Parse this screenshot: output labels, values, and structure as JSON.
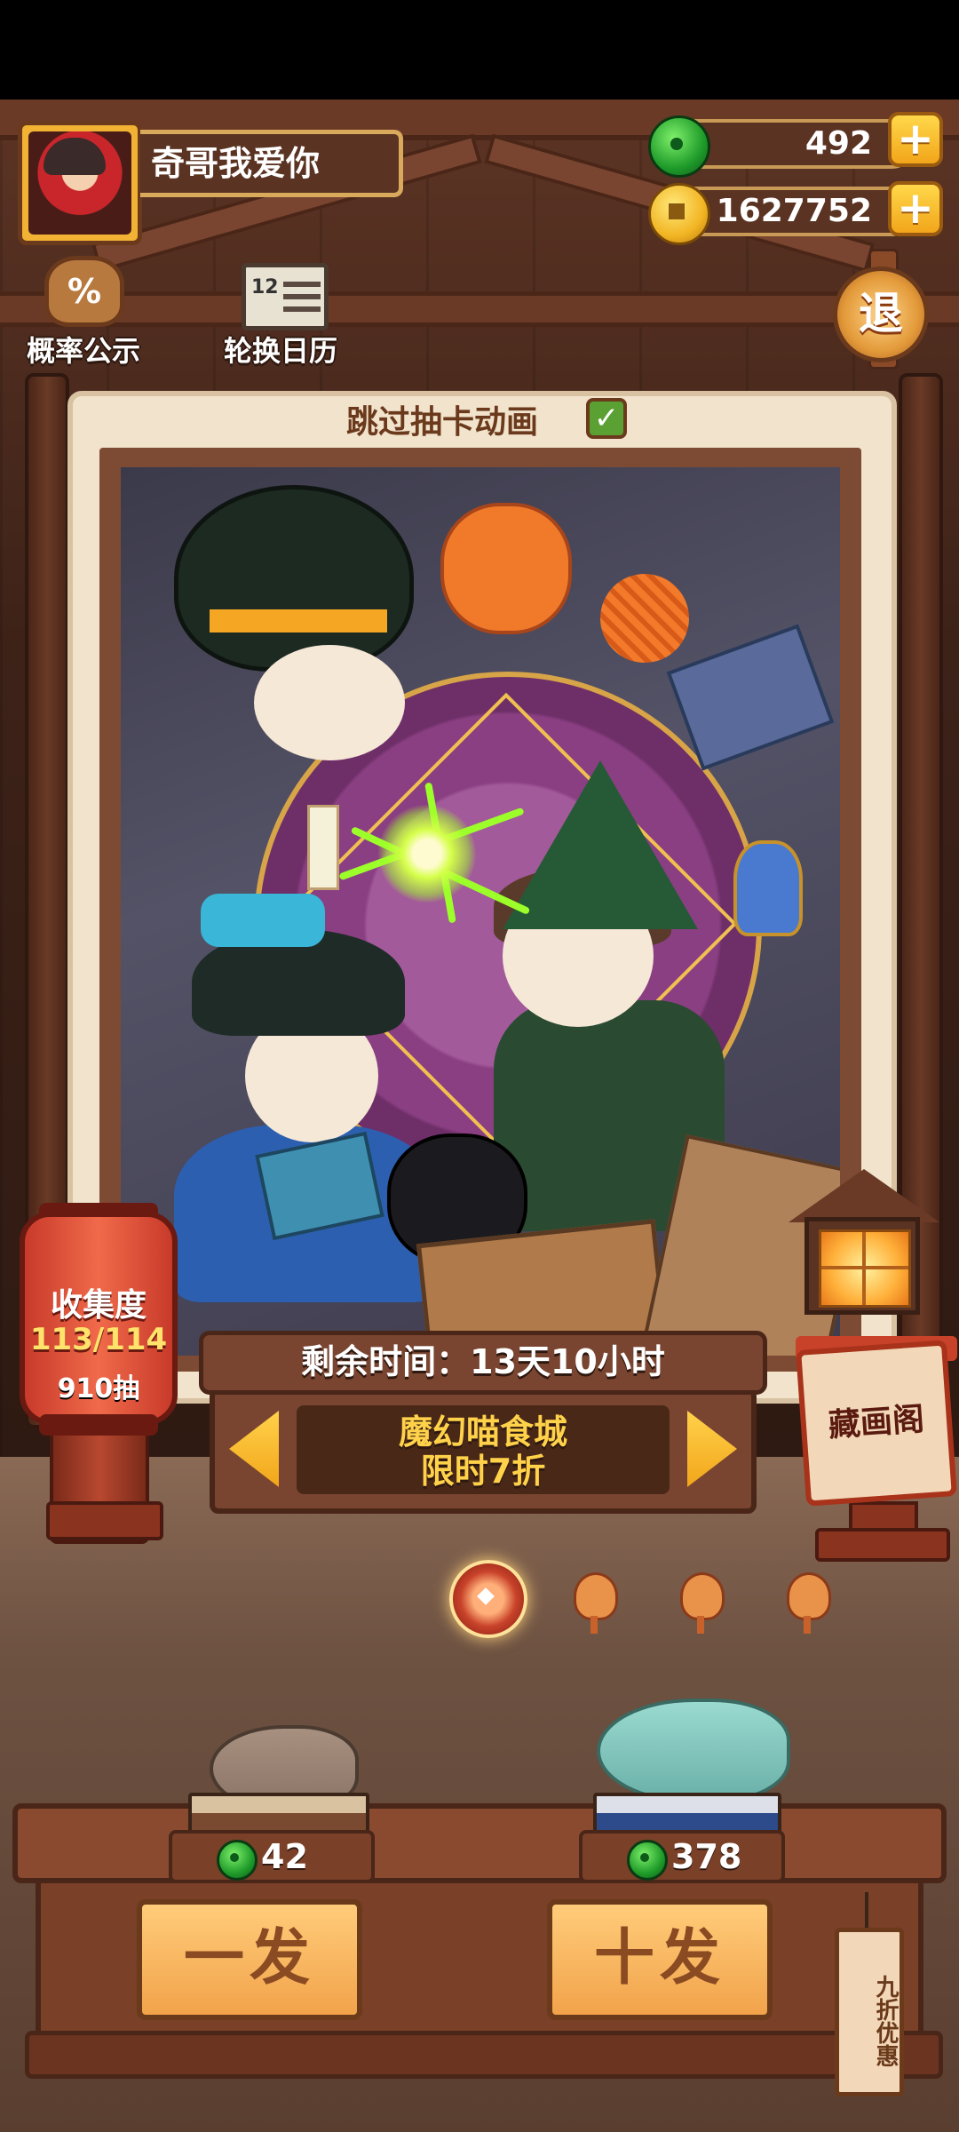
{
  "player": {
    "name": "奇哥我爱你"
  },
  "currency": {
    "jade": "492",
    "coins": "1627752"
  },
  "top_buttons": {
    "probability": "概率公示",
    "calendar": "轮换日历",
    "calendar_icon_text": "12",
    "exit": "退",
    "gear_symbol": "%"
  },
  "skip_animation": {
    "label": "跳过抽卡动画",
    "checked": true
  },
  "collection": {
    "label": "收集度",
    "progress": "113/114",
    "pulls": "910抽"
  },
  "event": {
    "remaining": "剩余时间：13天10小时",
    "title_line1": "魔幻喵食城",
    "title_line2": "限时7折"
  },
  "gallery": {
    "label": "藏画阁"
  },
  "pagination": {
    "total": 4,
    "active": 0
  },
  "draw": {
    "single": {
      "label": "一发",
      "cost": "42"
    },
    "ten": {
      "label": "十发",
      "cost": "378"
    },
    "discount_tag": "九折优惠"
  },
  "colors": {
    "accent": "#f2a51a",
    "jade": "#1f9b2a",
    "frame": "#f2e3cc",
    "wood": "#7a4530"
  },
  "icons": [
    "jade-icon",
    "coin-icon",
    "plus-icon",
    "gear-icon",
    "calendar-icon",
    "checkmark-icon",
    "arrow-left-icon",
    "arrow-right-icon",
    "lantern-icon"
  ]
}
